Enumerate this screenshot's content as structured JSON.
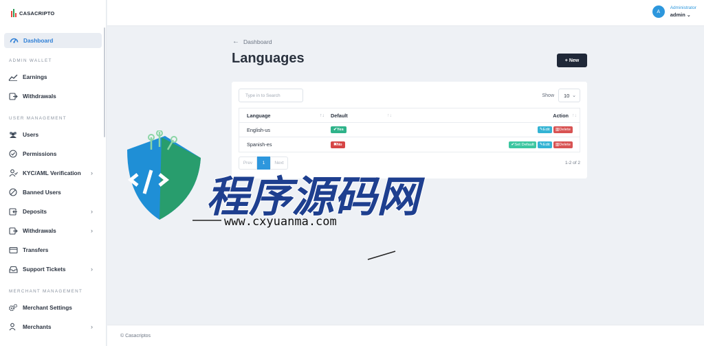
{
  "brand": {
    "name": "CASACRIPTO"
  },
  "sidebar": {
    "active": {
      "label": "Dashboard",
      "icon": "dashboard-icon"
    },
    "sections": {
      "wallet": "ADMIN WALLET",
      "users": "USER MANAGEMENT",
      "merchant": "MERCHANT MANAGEMENT"
    },
    "items": {
      "earnings": "Earnings",
      "withdrawals_wallet": "Withdrawals",
      "users": "Users",
      "permissions": "Permissions",
      "kyc": "KYC/AML Verification",
      "banned": "Banned Users",
      "deposits": "Deposits",
      "withdrawals": "Withdrawals",
      "transfers": "Transfers",
      "tickets": "Support Tickets",
      "merchant_settings": "Merchant Settings",
      "merchants": "Merchants"
    }
  },
  "user": {
    "initial": "A",
    "role": "Administrator",
    "name": "admin"
  },
  "main": {
    "breadcrumb": "Dashboard",
    "title": "Languages",
    "new_button": "+ New",
    "search_placeholder": "Type in to Search",
    "show_label": "Show",
    "show_value": "10",
    "columns": {
      "language": "Language",
      "default": "Default",
      "action": "Action"
    },
    "rows": [
      {
        "language": "English-us",
        "default": "Yes",
        "set_default": "",
        "edit": "Edit",
        "delete": "Delete"
      },
      {
        "language": "Spanish-es",
        "default": "No",
        "set_default": "Set Default",
        "edit": "Edit",
        "delete": "Delete"
      }
    ],
    "pager": {
      "prev": "Prev",
      "page": "1",
      "next": "Next"
    },
    "count": "1-2 of 2"
  },
  "footer": {
    "text": "© Casacriptos"
  },
  "watermark": {
    "title": "程序源码网",
    "url": "www.cxyuanma.com"
  },
  "colors": {
    "accent": "#2d97dd",
    "dark": "#1f2838",
    "success": "#2fb38a",
    "danger": "#d64545"
  }
}
